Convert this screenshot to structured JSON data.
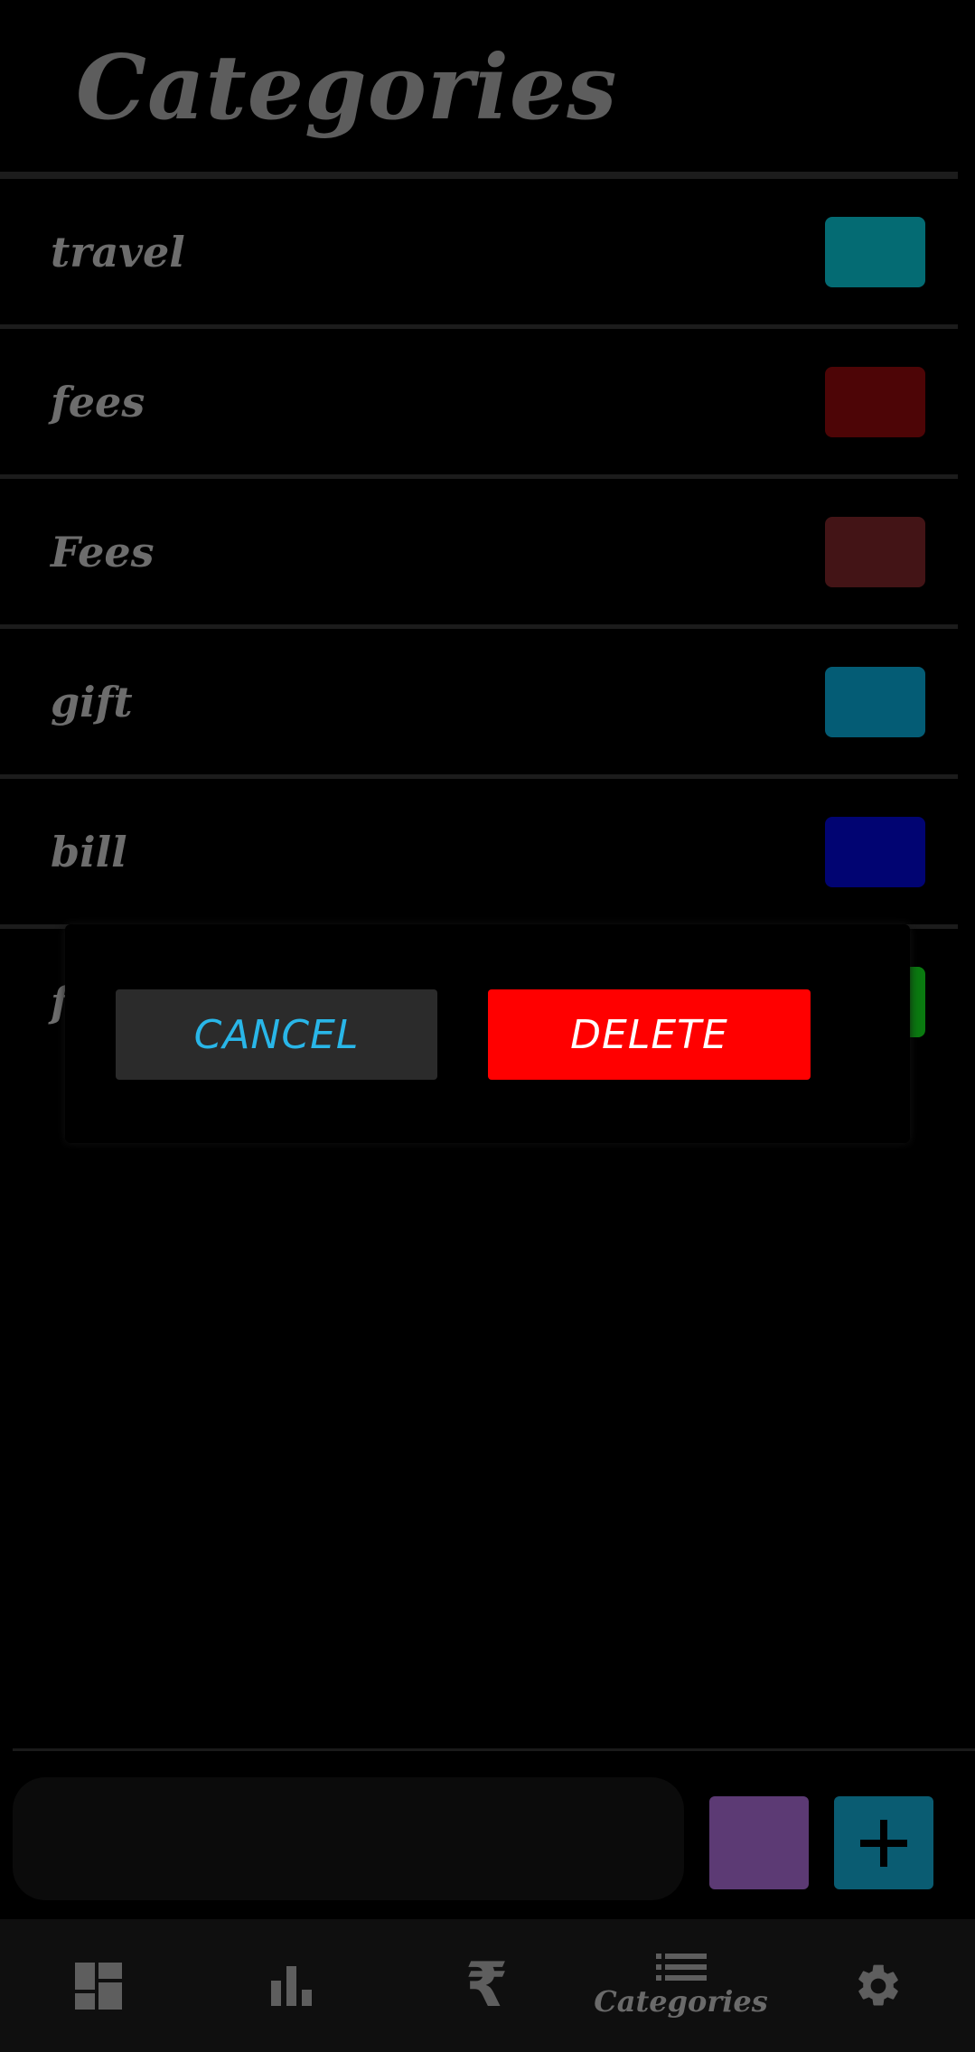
{
  "header": {
    "title": "Categories"
  },
  "categories": [
    {
      "name": "travel",
      "color": "#046b73"
    },
    {
      "name": "fees",
      "color": "#4d0506"
    },
    {
      "name": "Fees",
      "color": "#431416"
    },
    {
      "name": "gift",
      "color": "#045c75"
    },
    {
      "name": "bill",
      "color": "#010472"
    },
    {
      "name": "f",
      "color": "#0a7a10"
    }
  ],
  "dialog": {
    "cancel_label": "CANCEL",
    "delete_label": "DELETE"
  },
  "new_category": {
    "value": "",
    "color": "#5c3a74",
    "add_color": "#0a5c72"
  },
  "nav": {
    "items": [
      "dashboard-icon",
      "chart-icon",
      "rupee-icon",
      "categories-icon",
      "gear-icon"
    ],
    "active_label": "Categories",
    "rupee_glyph": "₹"
  }
}
